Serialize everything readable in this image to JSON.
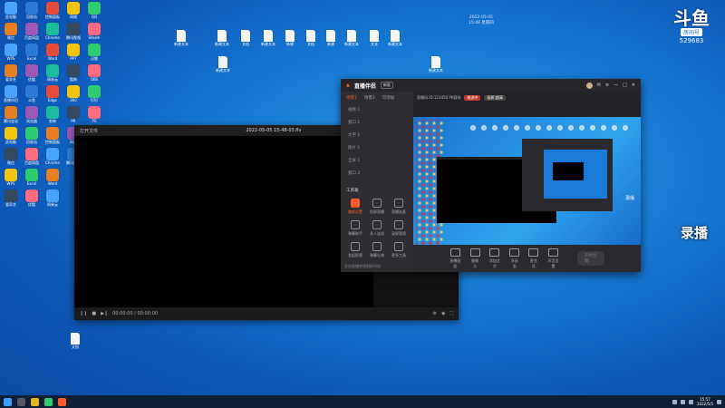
{
  "colors": {
    "accent": "#ff5a2a",
    "desktop": "#1678d4",
    "taskbar": "#0e1e33"
  },
  "overlay": {
    "brand_logo_text": "斗鱼",
    "room_tag": "房间号",
    "room_number": "529683",
    "record_label": "录播"
  },
  "desktop_clock": {
    "line1": "2022-05-05",
    "line2": "15:48 星期四"
  },
  "player": {
    "window_label": "打开文件",
    "filename": "2022-05-05 15-48-03.flv",
    "time": "00:00:00 / 00:00:00"
  },
  "stream_tool": {
    "brand": "直播伴侣",
    "badge": "新版",
    "tabs": [
      "场景1",
      "场景2",
      "可添加"
    ],
    "scenes": [
      "视频 1",
      "窗口 1",
      "文字 1",
      "图片 1",
      "全屏 1",
      "窗口 2"
    ],
    "tools_title": "工具箱",
    "tools": [
      "美颜设置",
      "投屏直播",
      "直播连麦",
      "弹幕助手",
      "多人连线",
      "录屏管理",
      "发起投票",
      "弹幕礼物",
      "更多工具"
    ],
    "footnote": "开启直播并找到好伙伴",
    "info_left": "直播间 ID:123456 PK赛场",
    "info_pill1": "推流中",
    "info_pill2": "画质:超清",
    "preview_label": "录播",
    "bottom_tools": [
      "直播画面",
      "摄像头",
      "添加文字",
      "多画面",
      "麦克风",
      "声音设置"
    ],
    "go_live": "开始直播"
  },
  "desktop_icons": [
    "此电脑",
    "回收站",
    "控制面板",
    "网络",
    "QQ",
    "微信",
    "百度网盘",
    "Chrome",
    "腾讯视频",
    "Steam",
    "WPS",
    "Excel",
    "Word",
    "PPT",
    "迅雷",
    "爱奇艺",
    "优酷",
    "网易云",
    "酷狗",
    "OBS",
    "直播伴侣",
    "斗鱼",
    "Edge",
    "360",
    "钉钉",
    "腾讯会议",
    "浏览器",
    "剪映",
    "PR",
    "PS"
  ],
  "top_files": [
    "新建文本",
    "新建文本",
    "文档",
    "新建文本",
    "新建",
    "文档",
    "新建",
    "新建文本",
    "文本",
    "新建文本"
  ],
  "taskbar": {
    "time": "15:57",
    "date": "2022/5/5"
  }
}
